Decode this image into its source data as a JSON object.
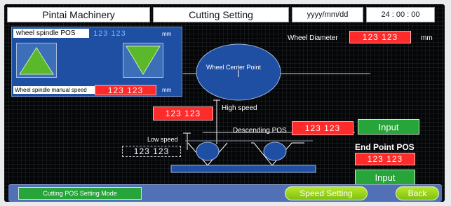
{
  "header": {
    "company": "Pintai Machinery",
    "screen_title": "Cutting Setting",
    "date": "yyyy/mm/dd",
    "time": "24 : 00 : 00"
  },
  "spindle_panel": {
    "pos_label": "wheel spindle POS",
    "pos_value": "123 123",
    "pos_unit": "mm",
    "manual_speed_label": "Wheel spindle manual speed",
    "manual_speed_value": "123 123",
    "manual_speed_unit": "mm"
  },
  "wheel_diameter": {
    "label": "Wheel Diameter",
    "value": "123 123",
    "unit": "mm"
  },
  "diagram": {
    "wheel_center_label": "Wheel Center Point",
    "high_speed_label": "High speed",
    "high_speed_value": "123 123",
    "low_speed_label": "Low speed",
    "low_speed_value": "123 123"
  },
  "descending": {
    "label": "Descending POS",
    "value": "123 123",
    "input_label": "Input"
  },
  "end_point": {
    "label": "End Point POS",
    "value": "123 123",
    "input_label": "Input"
  },
  "bottom_bar": {
    "mode_label": "Cutting POS Setting Mode",
    "speed_setting_label": "Speed Setting",
    "back_label": "Back"
  },
  "colors": {
    "value_box": "#ff2a2a",
    "input_button": "#27a43a",
    "panel_blue": "#1f4fa3",
    "pill_green": "#9bd41e"
  }
}
